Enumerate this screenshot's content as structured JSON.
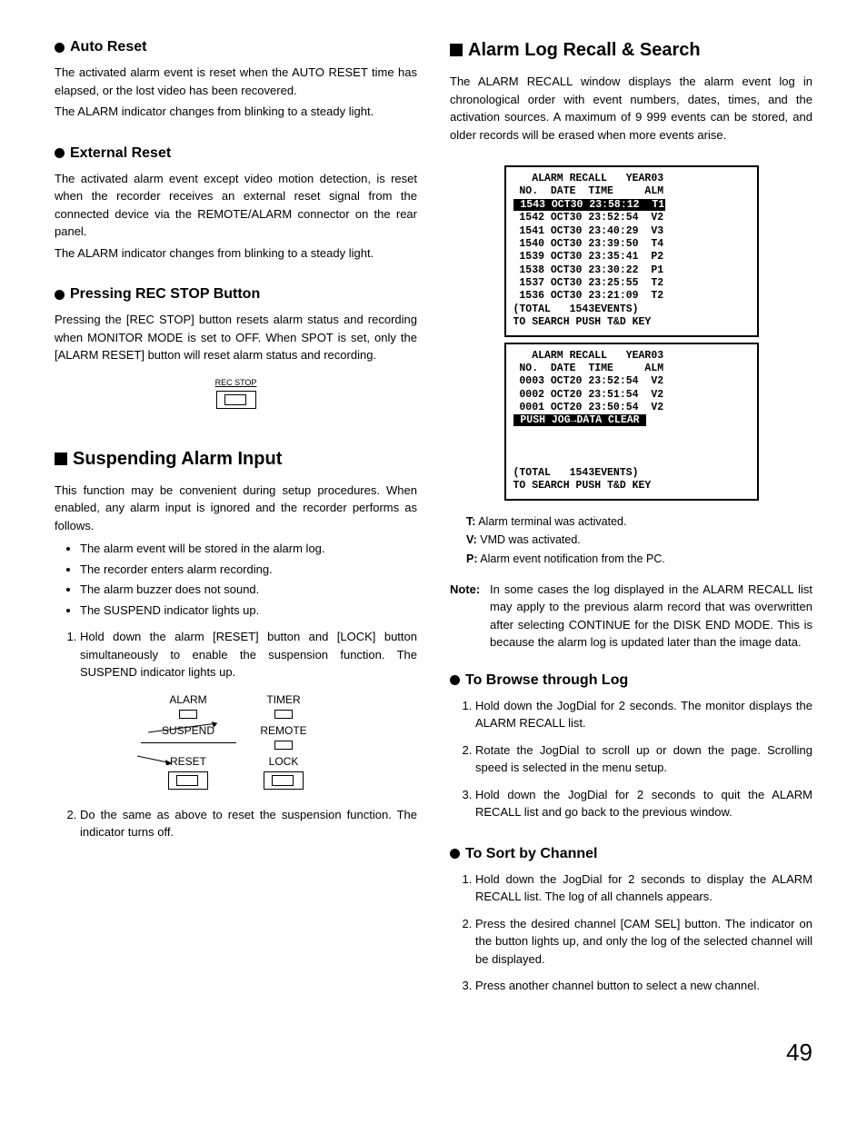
{
  "page_number": "49",
  "left": {
    "auto_reset": {
      "heading": "Auto Reset",
      "p1": "The activated alarm event is reset when the AUTO RESET time has elapsed, or the lost video has been recovered.",
      "p2": "The ALARM indicator changes from blinking to a steady light."
    },
    "external_reset": {
      "heading": "External Reset",
      "p1": "The activated alarm event except video motion detection, is reset when the recorder receives an external reset signal from the connected device via the REMOTE/ALARM connector on the rear panel.",
      "p2": "The ALARM indicator changes from blinking to a steady light."
    },
    "rec_stop": {
      "heading": "Pressing REC STOP Button",
      "p1": "Pressing the [REC STOP] button resets alarm status and recording when MONITOR MODE is set to OFF. When SPOT is set, only the [ALARM RESET] button will reset alarm status and recording.",
      "fig_label": "REC STOP"
    },
    "suspending": {
      "heading": "Suspending Alarm Input",
      "p1": "This function may be convenient during setup procedures. When enabled, any alarm input is ignored and the recorder performs as follows.",
      "bullets": [
        "The alarm event will be stored in the alarm log.",
        "The recorder enters alarm recording.",
        "The alarm buzzer does not sound.",
        "The SUSPEND indicator lights up."
      ],
      "step1": "Hold down the alarm [RESET] button and [LOCK] button simultaneously to enable the suspension function. The SUSPEND indicator lights up.",
      "step2": "Do the same as above to reset the suspension function. The indicator turns off.",
      "panel": {
        "alarm": "ALARM",
        "timer": "TIMER",
        "suspend": "SUSPEND",
        "remote": "REMOTE",
        "reset": "RESET",
        "lock": "LOCK"
      }
    }
  },
  "right": {
    "alarm_log": {
      "heading": "Alarm Log Recall & Search",
      "p1": "The ALARM RECALL window displays the alarm event log in chronological order with event numbers, dates, times, and the activation sources. A maximum of 9 999 events can be stored, and older records will be erased when more events arise."
    },
    "screen1": {
      "title": "   ALARM RECALL   YEAR03",
      "header": " NO.  DATE  TIME     ALM",
      "rows": [
        {
          "no": "1543",
          "date": "OCT30",
          "time": "23:58:12",
          "alm": "T1",
          "hl": true
        },
        {
          "no": "1542",
          "date": "OCT30",
          "time": "23:52:54",
          "alm": "V2"
        },
        {
          "no": "1541",
          "date": "OCT30",
          "time": "23:40:29",
          "alm": "V3"
        },
        {
          "no": "1540",
          "date": "OCT30",
          "time": "23:39:50",
          "alm": "T4"
        },
        {
          "no": "1539",
          "date": "OCT30",
          "time": "23:35:41",
          "alm": "P2"
        },
        {
          "no": "1538",
          "date": "OCT30",
          "time": "23:30:22",
          "alm": "P1"
        },
        {
          "no": "1537",
          "date": "OCT30",
          "time": "23:25:55",
          "alm": "T2"
        },
        {
          "no": "1536",
          "date": "OCT30",
          "time": "23:21:09",
          "alm": "T2"
        }
      ],
      "total": "(TOTAL   1543EVENTS)",
      "hint": "TO SEARCH PUSH T&D KEY"
    },
    "screen2": {
      "title": "   ALARM RECALL   YEAR03",
      "header": " NO.  DATE  TIME     ALM",
      "rows": [
        {
          "no": "0003",
          "date": "OCT20",
          "time": "23:52:54",
          "alm": "V2"
        },
        {
          "no": "0002",
          "date": "OCT20",
          "time": "23:51:54",
          "alm": "V2"
        },
        {
          "no": "0001",
          "date": "OCT20",
          "time": "23:50:54",
          "alm": "V2"
        }
      ],
      "clear": " PUSH JOG→DATA CLEAR ",
      "total": "(TOTAL   1543EVENTS)",
      "hint": "TO SEARCH PUSH T&D KEY"
    },
    "legend": {
      "t": "T:",
      "t_text": " Alarm terminal was activated.",
      "v": "V:",
      "v_text": " VMD was activated.",
      "p": "P:",
      "p_text": " Alarm event notification from the PC."
    },
    "note_label": "Note:",
    "note": "In some cases the log displayed in the ALARM RECALL list may apply to the previous alarm record that was overwritten after selecting CONTINUE for the DISK END MODE. This is because the alarm log is updated later than the image data.",
    "browse": {
      "heading": "To Browse through Log",
      "steps": [
        "Hold down the JogDial for 2 seconds. The monitor displays the ALARM RECALL list.",
        "Rotate the JogDial to scroll up or down the page. Scrolling speed is selected in the menu setup.",
        "Hold down the JogDial for 2 seconds to quit the ALARM RECALL list and go back to the previous window."
      ]
    },
    "sort": {
      "heading": "To Sort by Channel",
      "steps": [
        "Hold down the JogDial for 2 seconds to display the ALARM RECALL list. The log of all channels appears.",
        "Press the desired channel [CAM SEL] button. The indicator on the button lights up, and only the log of the selected channel will be displayed.",
        "Press another channel button to select a new channel."
      ]
    }
  }
}
